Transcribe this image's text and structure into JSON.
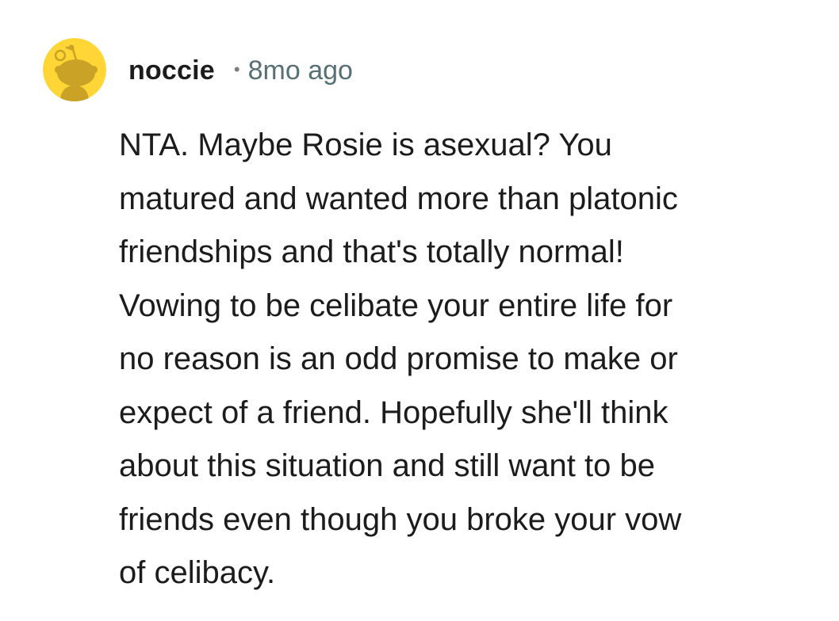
{
  "comment": {
    "author": {
      "username": "noccie",
      "avatar_icon": "snoo-avatar-icon",
      "avatar_bg": "#ffd635"
    },
    "separator": "•",
    "timestamp": "8mo ago",
    "body_lines": [
      "NTA. Maybe Rosie is asexual? You",
      "matured and wanted more than platonic",
      "friendships and that's totally normal!",
      "Vowing to be celibate your entire life for",
      "no reason is an odd promise to make or",
      "expect of a friend. Hopefully she'll think",
      "about this situation and still want to be",
      "friends even though you broke your vow",
      "of celibacy."
    ]
  }
}
